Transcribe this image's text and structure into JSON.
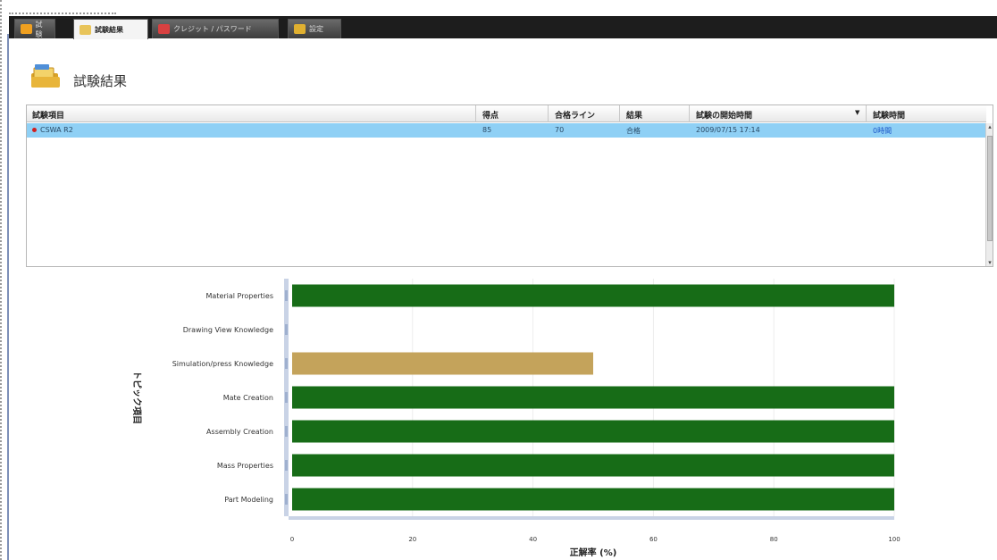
{
  "tabs": [
    {
      "label": "試験",
      "active": false,
      "icon": "star-icon",
      "color": "#f0a020"
    },
    {
      "label": "試験結果",
      "active": true,
      "icon": "notepad-icon",
      "color": "#e8c45a"
    },
    {
      "label": "クレジット / パスワード",
      "active": false,
      "icon": "card-icon",
      "color": "#d84040"
    },
    {
      "label": "設定",
      "active": false,
      "icon": "gear-icon",
      "color": "#e0b030"
    }
  ],
  "page": {
    "title": "試験結果",
    "icon": "folder-icon"
  },
  "table": {
    "columns": [
      "試験項目",
      "得点",
      "合格ライン",
      "結果",
      "試験の開始時間",
      "試験時間"
    ],
    "rows": [
      {
        "item": "CSWA R2",
        "score": "85",
        "pass_line": "70",
        "result": "合格",
        "start": "2009/07/15 17:14",
        "duration": "0時間"
      }
    ]
  },
  "chart_data": {
    "type": "bar",
    "orientation": "horizontal",
    "categories": [
      "Material Properties",
      "Drawing View Knowledge",
      "Simulation/press Knowledge",
      "Mate Creation",
      "Assembly Creation",
      "Mass Properties",
      "Part Modeling"
    ],
    "values": [
      100,
      0,
      50,
      100,
      100,
      100,
      100
    ],
    "colors": [
      "#176c17",
      "#176c17",
      "#c4a35b",
      "#176c17",
      "#176c17",
      "#176c17",
      "#176c17"
    ],
    "xlabel": "正解率 (%)",
    "ylabel": "トピック項目",
    "xlim": [
      0,
      100
    ],
    "ticks": [
      0,
      20,
      40,
      60,
      80,
      100
    ],
    "grid": true
  }
}
